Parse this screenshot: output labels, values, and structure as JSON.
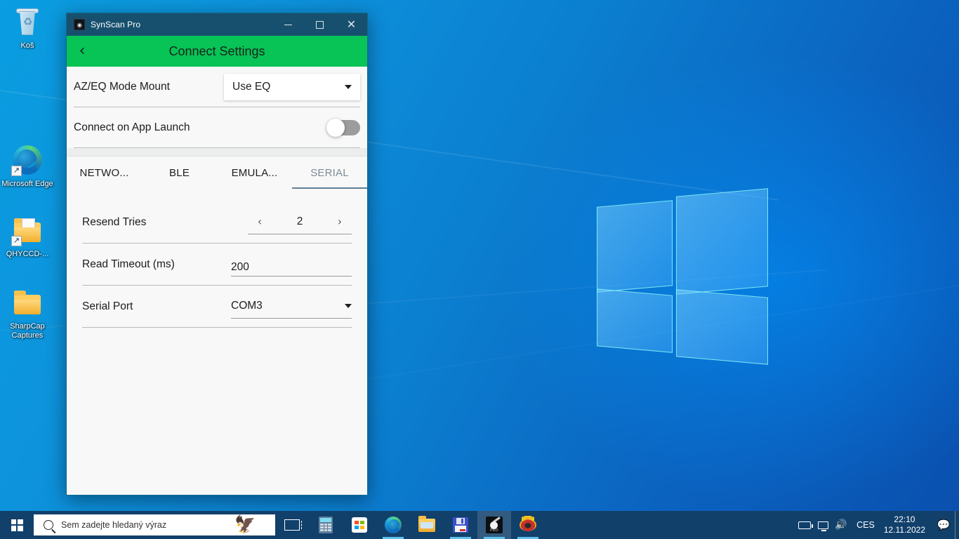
{
  "desktop": {
    "icons": [
      {
        "name": "recycle-bin",
        "label": "Koš"
      },
      {
        "name": "microsoft-edge",
        "label": "Microsoft Edge"
      },
      {
        "name": "qhyccd-folder",
        "label": "QHYCCD-..."
      },
      {
        "name": "sharpcap-captures-folder",
        "label": "SharpCap Captures"
      }
    ]
  },
  "window": {
    "title": "SynScan Pro",
    "controls": {
      "minimize": "–",
      "maximize": "□",
      "close": "✕"
    },
    "header": {
      "back_icon": "‹",
      "title": "Connect Settings",
      "accent_color": "#08c356"
    },
    "top_settings": [
      {
        "label": "AZ/EQ Mode Mount",
        "control": "dropdown",
        "value": "Use EQ"
      },
      {
        "label": "Connect on App Launch",
        "control": "toggle",
        "value": "off"
      }
    ],
    "tabs": [
      {
        "label": "NETWO...",
        "active": false
      },
      {
        "label": "BLE",
        "active": false
      },
      {
        "label": "EMULA...",
        "active": false
      },
      {
        "label": "SERIAL",
        "active": true
      }
    ],
    "serial_form": {
      "resend_tries": {
        "label": "Resend Tries",
        "value": "2",
        "decrement_icon": "‹",
        "increment_icon": "›"
      },
      "read_timeout": {
        "label": "Read Timeout (ms)",
        "value": "200"
      },
      "serial_port": {
        "label": "Serial Port",
        "value": "COM3"
      }
    }
  },
  "taskbar": {
    "start_label": "Start",
    "search": {
      "placeholder": "Sem zadejte hledaný výraz",
      "icon": "search-icon",
      "decoration": "🦅"
    },
    "buttons": [
      {
        "name": "task-view",
        "label": "Task View",
        "running": false,
        "active": false
      },
      {
        "name": "calculator",
        "label": "Calculator",
        "running": false,
        "active": false
      },
      {
        "name": "microsoft-store",
        "label": "Microsoft Store",
        "running": false,
        "active": false
      },
      {
        "name": "microsoft-edge",
        "label": "Microsoft Edge",
        "running": true,
        "active": false
      },
      {
        "name": "file-explorer",
        "label": "File Explorer",
        "running": false,
        "active": false
      },
      {
        "name": "sharpcap",
        "label": "SharpCap",
        "running": true,
        "active": false
      },
      {
        "name": "synscan-pro",
        "label": "SynScan Pro",
        "running": true,
        "active": true
      },
      {
        "name": "gimp",
        "label": "GIMP",
        "running": true,
        "active": false
      }
    ],
    "tray": {
      "power_icon": "power-plug-icon",
      "network_icon": "network-icon",
      "volume_icon": "🔊",
      "language": "CES",
      "time": "22:10",
      "date": "12.11.2022",
      "action_center_icon": "⬜"
    }
  }
}
